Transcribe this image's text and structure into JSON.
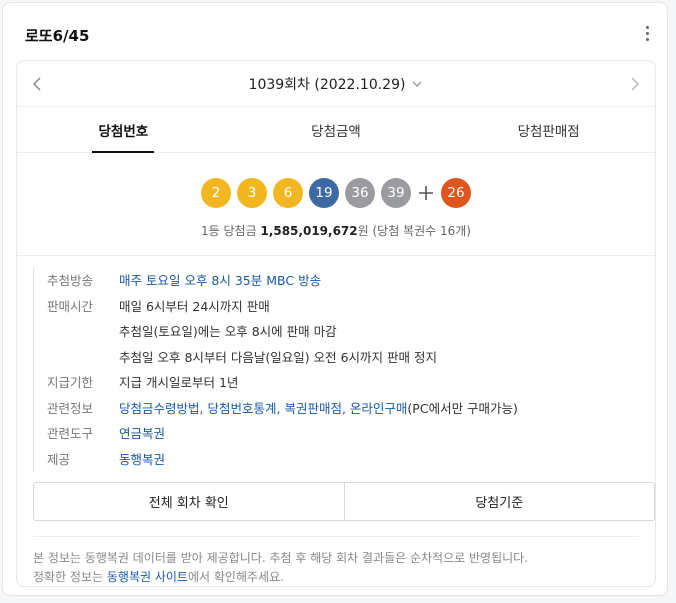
{
  "card": {
    "title": "로또6/45",
    "more_icon": "more-vertical-icon"
  },
  "round": {
    "label": "1039회차 (2022.10.29)",
    "prev_icon": "chevron-left-icon",
    "next_icon": "chevron-right-icon",
    "dropdown_icon": "chevron-down-icon"
  },
  "tabs": [
    {
      "label": "당첨번호",
      "active": true
    },
    {
      "label": "당첨금액",
      "active": false
    },
    {
      "label": "당첨판매점",
      "active": false
    }
  ],
  "numbers": [
    {
      "value": "2",
      "color": "#f2b720"
    },
    {
      "value": "3",
      "color": "#f2b720"
    },
    {
      "value": "6",
      "color": "#f2b720"
    },
    {
      "value": "19",
      "color": "#3d6aa5"
    },
    {
      "value": "36",
      "color": "#9a9ca1"
    },
    {
      "value": "39",
      "color": "#9a9ca1"
    }
  ],
  "bonus": {
    "value": "26",
    "color": "#e0541f",
    "plus_icon": "plus-icon"
  },
  "prize": {
    "prefix": "1등 당첨금",
    "amount": "1,585,019,672",
    "suffix": "원 (당첨 복권수 16개)"
  },
  "info": {
    "draw": {
      "label": "추첨방송",
      "value": "매주 토요일 오후 8시 35분 MBC 방송"
    },
    "sale": {
      "label": "판매시간",
      "lines": [
        "매일 6시부터 24시까지 판매",
        "추첨일(토요일)에는 오후 8시에 판매 마감",
        "추첨일 오후 8시부터 다음날(일요일) 오전 6시까지 판매 정지"
      ]
    },
    "payment": {
      "label": "지급기한",
      "value": "지급 개시일로부터 1년"
    },
    "related": {
      "label": "관련정보",
      "links": [
        "당첨금수령방법",
        "당첨번호통계",
        "복권판매점",
        "온라인구매"
      ],
      "note": "(PC에서만 구매가능)"
    },
    "tools": {
      "label": "관련도구",
      "link": "연금복권"
    },
    "provider": {
      "label": "제공",
      "link": "동행복권"
    }
  },
  "buttons": {
    "all_rounds": "전체 회차 확인",
    "criteria": "당첨기준"
  },
  "notice": {
    "line1": "본 정보는 동행복권 데이터를 받아 제공합니다. 추첨 후 해당 회차 결과들은 순차적으로 반영됩니다.",
    "line2_prefix": "정확한 정보는 ",
    "line2_link": "동행복권 사이트",
    "line2_suffix": "에서 확인해주세요."
  }
}
